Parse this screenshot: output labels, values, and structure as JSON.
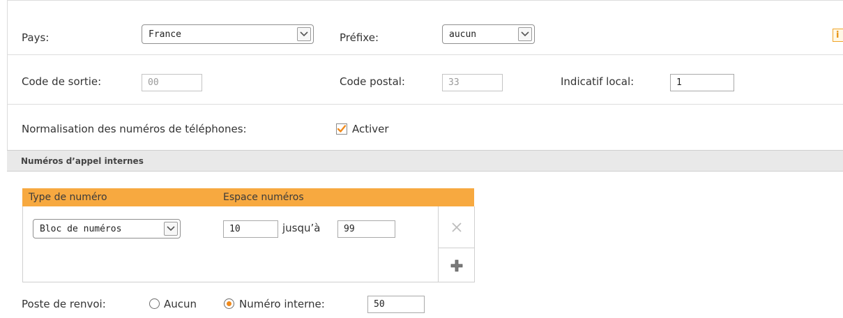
{
  "location": {
    "country_label": "Pays:",
    "country_value": "France",
    "prefix_label": "Préfixe:",
    "prefix_value": "aucun",
    "info_icon_label": "i"
  },
  "codes": {
    "exit_code_label": "Code de sortie:",
    "exit_code_value": "00",
    "postal_code_label": "Code postal:",
    "postal_code_value": "33",
    "local_code_label": "Indicatif local:",
    "local_code_value": "1"
  },
  "normalization": {
    "label": "Normalisation des numéros de téléphones:",
    "checkbox_label": "Activer",
    "checked": true
  },
  "internal_numbers": {
    "section_title": "Numéros d’appel internes",
    "columns": [
      "Type de numéro",
      "Espace numéros"
    ],
    "rows": [
      {
        "type": "Bloc de numéros",
        "from": "10",
        "to_label": "jusqu’à",
        "to": "99"
      }
    ]
  },
  "forwarding": {
    "label": "Poste de renvoi:",
    "option_none": "Aucun",
    "option_internal": "Numéro interne:",
    "selected": "internal",
    "internal_value": "50"
  },
  "colors": {
    "accent": "#f7a940",
    "radio_dot": "#f08a1c",
    "section_bg": "#e9e9e9"
  },
  "icons": {
    "dropdown": "chevron-down-icon",
    "delete": "close-icon",
    "add": "plus-icon",
    "info": "info-icon",
    "checkbox": "checkmark-icon"
  }
}
